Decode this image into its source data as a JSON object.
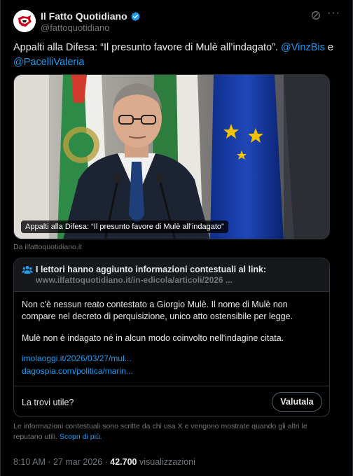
{
  "author": {
    "name": "Il Fatto Quotidiano",
    "handle": "@fattoquotidiano",
    "avatar_icon": "newspaper-logo-icon"
  },
  "tweet": {
    "text_before": "Appalti alla Difesa: “Il presunto favore di Mulè all’indagato”. ",
    "mention_1": "@VinzBis",
    "text_between": " e ",
    "mention_2": "@PacelliValeria"
  },
  "media": {
    "caption": "Appalti alla Difesa: “Il presunto favore di Mulè all’indagato”",
    "source": "Da ilfattoquotidiano.it"
  },
  "note": {
    "title": "I lettori hanno aggiunto informazioni contestuali al link:",
    "link": "www.ilfattoquotidiano.it/in-edicola/articoli/2026 ...",
    "paragraph_1": "Non c'è nessun reato contestato a Giorgio Mulè. Il nome di Mulè non compare nel decreto di perquisizione, unico atto ostensibile per legge.",
    "paragraph_2": "Mulè non è indagato né in alcun modo coinvolto nell'indagine citata.",
    "source_1": "imolaoggi.it/2026/03/27/mul...",
    "source_2": "dagospia.com/politica/marin...",
    "question": "La trovi utile?",
    "rate_label": "Valutala"
  },
  "disclaimer": {
    "text": "Le informazioni contestuali sono scritte da chi usa X e vengono mostrate quando gli altri le reputano utili. ",
    "more_link": "Scopri di più."
  },
  "meta": {
    "time": "8:10 AM",
    "separator": " · ",
    "date": "27 mar 2026",
    "views_count": "42.700",
    "views_label": " visualizzazioni"
  },
  "colors": {
    "background": "#000000",
    "text": "#e7e9ea",
    "muted": "#71767b",
    "accent": "#1d9bf0",
    "border": "#2f3336"
  }
}
